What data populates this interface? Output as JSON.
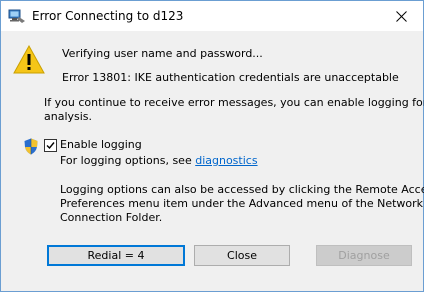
{
  "window": {
    "title": "Error Connecting to d123",
    "title_icon": "network-connection-icon",
    "close_icon": "close-icon"
  },
  "message": {
    "status_line": "Verifying user name and password...",
    "error_line": "Error 13801: IKE authentication credentials are unacceptable",
    "advice_line1": "If you continue to receive error messages, you can enable logging for",
    "advice_line2": "analysis."
  },
  "logging": {
    "checkbox_label": "Enable logging",
    "checked": true,
    "options_prefix": "For logging options, see ",
    "options_link": "diagnostics",
    "info_line1": "Logging options can also be accessed by clicking the Remote Access",
    "info_line2": "Preferences menu item under the Advanced menu of the Network",
    "info_line3": "Connection Folder."
  },
  "buttons": {
    "redial": "Redial = 4",
    "close": "Close",
    "diagnose": "Diagnose"
  },
  "colors": {
    "link": "#0066cc",
    "warning": "#f5c518",
    "accent": "#0078d7"
  }
}
